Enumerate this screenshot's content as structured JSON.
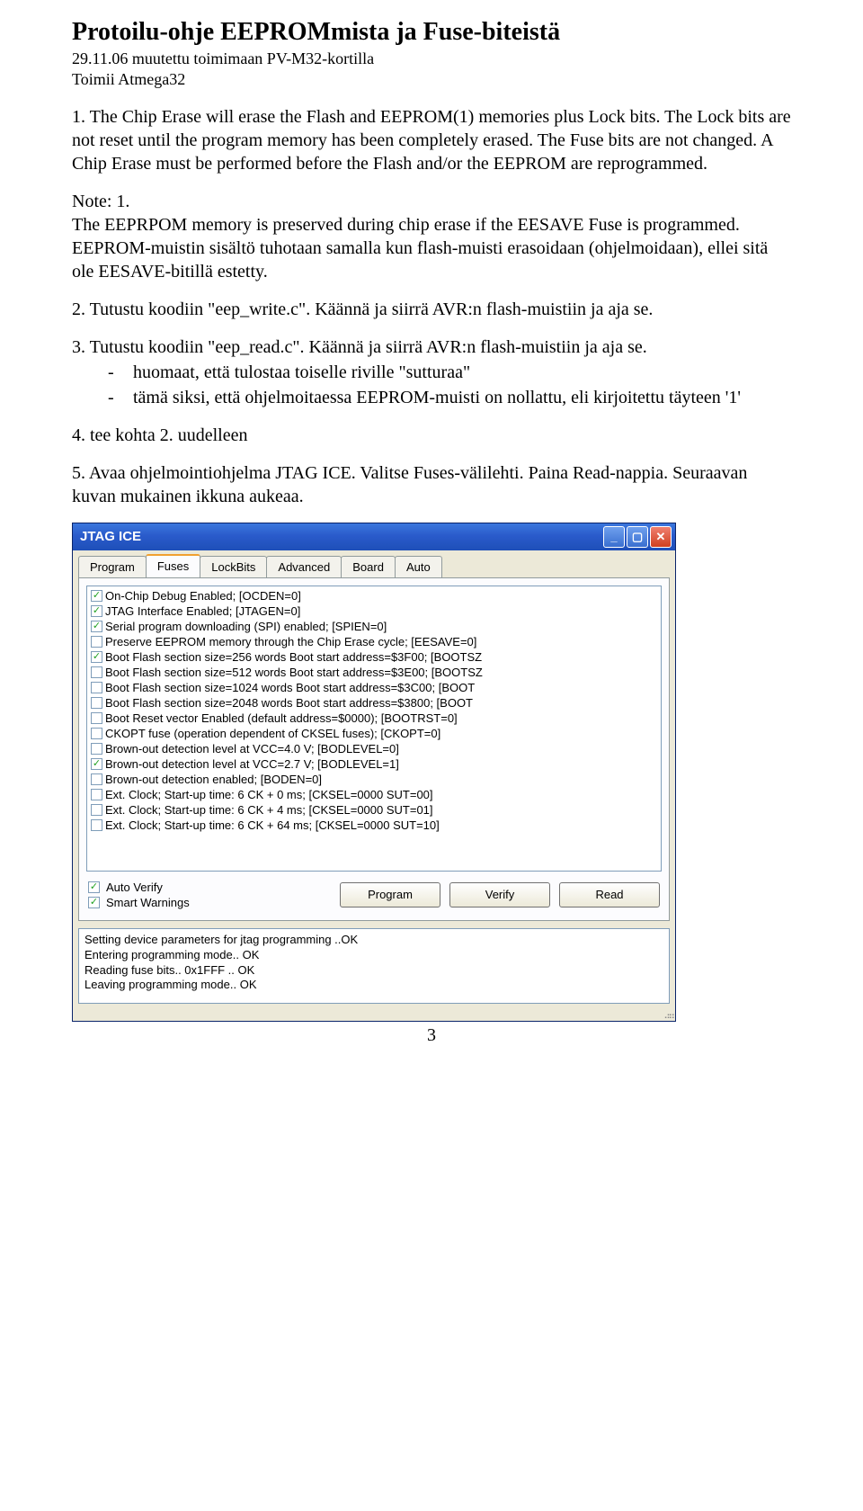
{
  "header": {
    "title": "Protoilu-ohje EEPROMmista ja Fuse-biteistä",
    "sub1": "29.11.06 muutettu toimimaan PV-M32-kortilla",
    "sub2": "Toimii Atmega32"
  },
  "para1": "1. The Chip Erase will erase the Flash and EEPROM(1) memories plus Lock bits. The Lock bits are not reset until the program memory has been completely erased. The Fuse bits are not changed. A Chip Erase must be performed before the Flash and/or the EEPROM are reprogrammed.",
  "para2": "Note: 1.\nThe EEPRPOM memory is preserved during chip erase if the EESAVE Fuse is programmed. EEPROM-muistin sisältö tuhotaan samalla kun flash-muisti erasoidaan (ohjelmoidaan), ellei sitä ole EESAVE-bitillä estetty.",
  "para3": "2. Tutustu koodiin \"eep_write.c\". Käännä ja siirrä AVR:n flash-muistiin ja aja se.",
  "para4_intro": "3. Tutustu koodiin \"eep_read.c\". Käännä ja siirrä AVR:n flash-muistiin ja aja se.",
  "para4_items": [
    "huomaat, että tulostaa toiselle riville \"sutturaa\"",
    "tämä siksi, että ohjelmoitaessa EEPROM-muisti on nollattu, eli kirjoitettu täyteen '1'"
  ],
  "para5": "4. tee kohta 2. uudelleen",
  "para6": "5. Avaa ohjelmointiohjelma JTAG ICE. Valitse Fuses-välilehti. Paina Read-nappia. Seuraavan kuvan mukainen ikkuna aukeaa.",
  "page_num": "3",
  "window": {
    "title": "JTAG ICE",
    "tabs": [
      "Program",
      "Fuses",
      "LockBits",
      "Advanced",
      "Board",
      "Auto"
    ],
    "active_tab": 1,
    "fuses": [
      {
        "checked": true,
        "label": "On-Chip Debug Enabled; [OCDEN=0]"
      },
      {
        "checked": true,
        "label": "JTAG Interface Enabled; [JTAGEN=0]"
      },
      {
        "checked": true,
        "label": "Serial program downloading (SPI) enabled; [SPIEN=0]"
      },
      {
        "checked": false,
        "label": "Preserve EEPROM memory through the Chip Erase cycle; [EESAVE=0]"
      },
      {
        "checked": true,
        "label": "Boot Flash section size=256 words Boot start address=$3F00; [BOOTSZ"
      },
      {
        "checked": false,
        "label": "Boot Flash section size=512 words Boot start address=$3E00; [BOOTSZ"
      },
      {
        "checked": false,
        "label": "Boot Flash section size=1024 words Boot start address=$3C00; [BOOT"
      },
      {
        "checked": false,
        "label": "Boot Flash section size=2048 words Boot start address=$3800; [BOOT"
      },
      {
        "checked": false,
        "label": "Boot Reset vector Enabled (default address=$0000); [BOOTRST=0]"
      },
      {
        "checked": false,
        "label": "CKOPT fuse (operation dependent of CKSEL fuses); [CKOPT=0]"
      },
      {
        "checked": false,
        "label": "Brown-out detection level at VCC=4.0 V; [BODLEVEL=0]"
      },
      {
        "checked": true,
        "label": "Brown-out detection level at VCC=2.7 V; [BODLEVEL=1]"
      },
      {
        "checked": false,
        "label": "Brown-out detection enabled; [BODEN=0]"
      },
      {
        "checked": false,
        "label": "Ext. Clock; Start-up time: 6 CK + 0 ms; [CKSEL=0000 SUT=00]"
      },
      {
        "checked": false,
        "label": "Ext. Clock; Start-up time: 6 CK + 4 ms; [CKSEL=0000 SUT=01]"
      },
      {
        "checked": false,
        "label": "Ext. Clock; Start-up time: 6 CK + 64 ms; [CKSEL=0000 SUT=10]"
      }
    ],
    "auto_verify": "Auto Verify",
    "smart_warnings": "Smart Warnings",
    "buttons": {
      "program": "Program",
      "verify": "Verify",
      "read": "Read"
    },
    "status": [
      "Setting device parameters for jtag programming ..OK",
      "Entering programming mode.. OK",
      "Reading fuse bits.. 0x1FFF .. OK",
      "Leaving programming mode.. OK"
    ]
  }
}
